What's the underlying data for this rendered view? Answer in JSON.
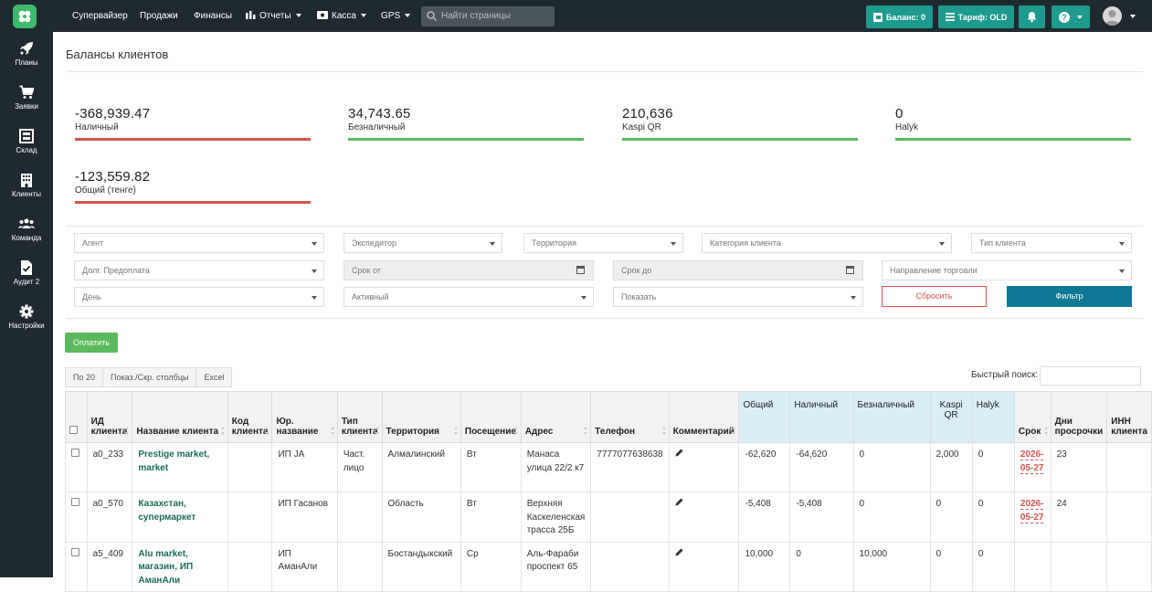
{
  "nav": {
    "items": [
      "Супервайзер",
      "Продажи",
      "Финансы",
      "Отчеты",
      "Касса",
      "GPS"
    ],
    "search_placeholder": "Найти страницы",
    "balance_label": "Баланс: 0",
    "tariff_label": "Тариф: OLD",
    "help_label": "?"
  },
  "sidebar": {
    "items": [
      "Планы",
      "Заявки",
      "Склад",
      "Клиенты",
      "Команда",
      "Аудит 2",
      "Настройки"
    ]
  },
  "page": {
    "title": "Балансы клиентов"
  },
  "stats": [
    {
      "value": "-368,939.47",
      "label": "Наличный",
      "color": "#d9534f"
    },
    {
      "value": "34,743.65",
      "label": "Безналичный",
      "color": "#5cb85c"
    },
    {
      "value": "210,636",
      "label": "Kaspi QR",
      "color": "#5cb85c"
    },
    {
      "value": "0",
      "label": "Halyk",
      "color": "#5cb85c"
    },
    {
      "value": "-123,559.82",
      "label": "Общий (тенге)",
      "color": "#d9534f"
    }
  ],
  "filters": {
    "agent": "Агент",
    "expeditor": "Экспедитор",
    "territory": "Территория",
    "client_category": "Категория клиента",
    "client_type": "Тип клиента",
    "debt_prepay": "Долг. Предоплата",
    "date_from": "Срок от",
    "date_to": "Срок до",
    "trade_direction": "Направление торговли",
    "day": "День",
    "active": "Активный",
    "show": "Показать",
    "reset": "Сбросить",
    "filter": "Фильтр"
  },
  "actions": {
    "pay": "Оплатить",
    "per_page": "По 20",
    "show_hide_cols": "Показ./Скр. столбцы",
    "excel": "Excel",
    "quick_search": "Быстрый поиск:"
  },
  "table": {
    "headers": {
      "id": "ИД клиента",
      "name": "Название клиента",
      "code": "Код клиента",
      "legal": "Юр. название",
      "type": "Тип клиента",
      "territory": "Территория",
      "visit": "Посещение",
      "address": "Адрес",
      "phone": "Телефон",
      "comment": "Комментарий",
      "total": "Общий",
      "cash": "Наличный",
      "noncash": "Безналичный",
      "kaspi": "Kaspi QR",
      "halyk": "Halyk",
      "due": "Срок",
      "overdue": "Дни просрочки",
      "inn": "ИНН клиента"
    },
    "rows": [
      {
        "id": "a0_233",
        "name": "Prestige market, market",
        "code": "",
        "legal": "ИП JA",
        "type": "Част. лицо",
        "territory": "Алмалинский",
        "visit": "Вт",
        "address": "Манаса улица 22/2 к7",
        "phone": "7777077638638",
        "total": "-62,620",
        "cash": "-64,620",
        "noncash": "0",
        "kaspi": "2,000",
        "halyk": "0",
        "due": "2026-05-27",
        "overdue": "23"
      },
      {
        "id": "a0_570",
        "name": "Казахстан, супермаркет",
        "code": "",
        "legal": "ИП Гасанов",
        "type": "",
        "territory": "Область",
        "visit": "Вт",
        "address": "Верхняя Каскеленская трасса 25Б",
        "phone": "",
        "total": "-5,408",
        "cash": "-5,408",
        "noncash": "0",
        "kaspi": "0",
        "halyk": "0",
        "due": "2026-05-27",
        "overdue": "24"
      },
      {
        "id": "a5_409",
        "name": "Alu market, магазин, ИП АманАли",
        "code": "",
        "legal": "ИП АманАли",
        "type": "",
        "territory": "Бостандыкский",
        "visit": "Ср",
        "address": "Аль-Фараби проспект 65",
        "phone": "",
        "total": "10,000",
        "cash": "0",
        "noncash": "10,000",
        "kaspi": "0",
        "halyk": "0",
        "due": "",
        "overdue": ""
      }
    ]
  }
}
